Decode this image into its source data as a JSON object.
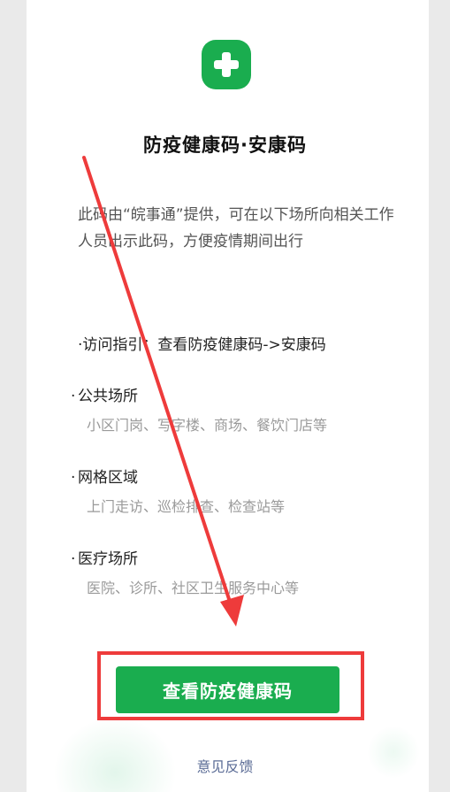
{
  "header": {
    "title": "防疫健康码·安康码"
  },
  "description": "此码由“皖事通”提供，可在以下场所向相关工作人员出示此码，方便疫情期间出行",
  "guide": "·访问指引：查看防疫健康码->安康码",
  "sections": [
    {
      "title": "公共场所",
      "subtitle": "小区门岗、写字楼、商场、餐饮门店等"
    },
    {
      "title": "网格区域",
      "subtitle": "上门走访、巡检排查、检查站等"
    },
    {
      "title": "医疗场所",
      "subtitle": "医院、诊所、社区卫生服务中心等"
    }
  ],
  "bullet": "·",
  "actions": {
    "primary_label": "查看防疫健康码",
    "feedback_label": "意见反馈"
  },
  "colors": {
    "brand_green": "#1aad4f",
    "annotation_red": "#ee3b3b",
    "link_blue": "#5b6c96"
  },
  "icons": {
    "logo": "medical-cross-icon",
    "annotation": "red-arrow-annotation"
  }
}
